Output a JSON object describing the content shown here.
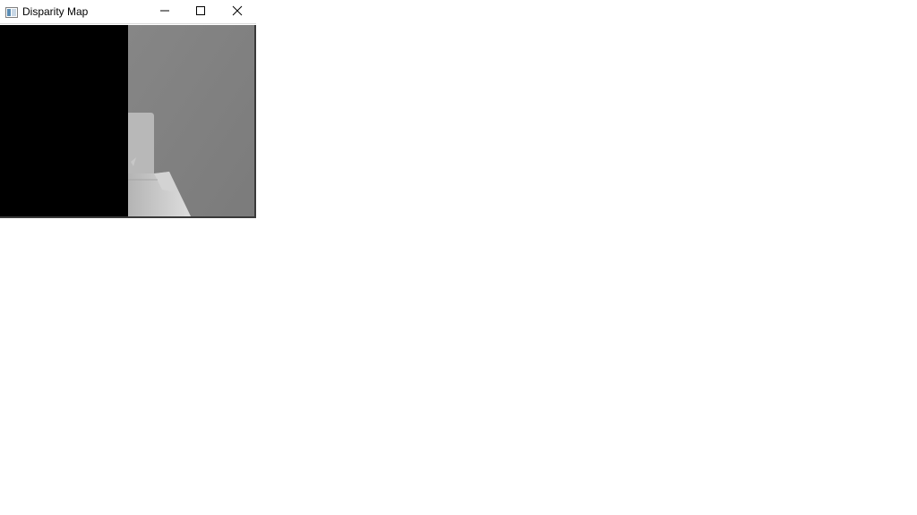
{
  "window": {
    "title": "Disparity Map",
    "app_icon": "window-app-icon",
    "controls": {
      "minimize_icon": "minimize-icon",
      "maximize_icon": "maximize-icon",
      "close_icon": "close-icon"
    }
  },
  "image_view": {
    "description_colors": {
      "background": "#000000",
      "disparity_region": "#7f7f7f",
      "near_object": "#b9b9b9",
      "nearest_object": "#d5d5d5"
    }
  }
}
